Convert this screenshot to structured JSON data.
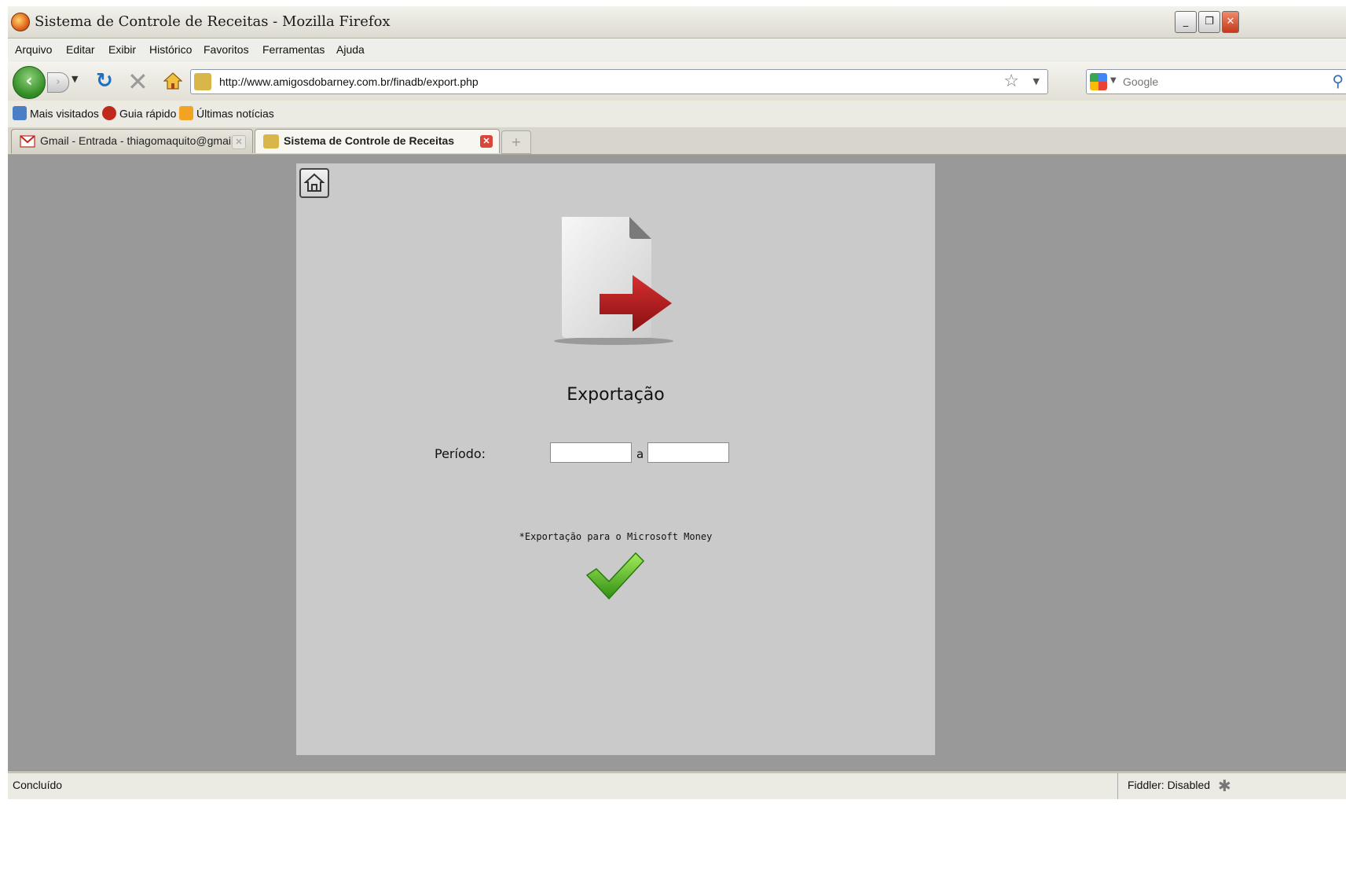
{
  "window": {
    "title": "Sistema de Controle de Receitas - Mozilla Firefox",
    "minimize": "_",
    "restore": "❐",
    "close": "✕"
  },
  "menu": [
    "Arquivo",
    "Editar",
    "Exibir",
    "Histórico",
    "Favoritos",
    "Ferramentas",
    "Ajuda"
  ],
  "nav": {
    "url": "http://www.amigosdobarney.com.br/finadb/export.php",
    "search_placeholder": "Google"
  },
  "bookmarks": [
    "Mais visitados",
    "Guia rápido",
    "Últimas notícias"
  ],
  "tabs": [
    {
      "label": "Gmail - Entrada - thiagomaquito@gmail....",
      "active": false
    },
    {
      "label": "Sistema de Controle de Receitas",
      "active": true
    }
  ],
  "page": {
    "title": "Exportação",
    "period_label": "Período:",
    "separator": "a",
    "date_from": "",
    "date_to": "",
    "note": "*Exportação para o Microsoft Money"
  },
  "status": {
    "text": "Concluído",
    "fiddler": "Fiddler: Disabled"
  },
  "colors": {
    "page_background": "#999999",
    "panel_background": "#cacaca",
    "arrow_red": "#b3171a",
    "check_green": "#3fa61a"
  },
  "icons": [
    "firefox-logo-icon",
    "back-arrow-icon",
    "forward-arrow-icon",
    "reload-icon",
    "stop-icon",
    "home-icon",
    "star-icon",
    "google-icon",
    "magnifier-icon",
    "gmail-icon",
    "export-document-icon",
    "checkmark-icon"
  ]
}
